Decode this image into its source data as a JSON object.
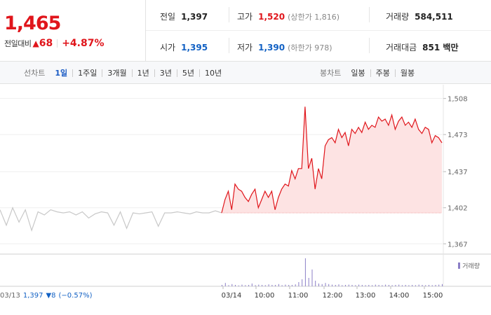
{
  "summary": {
    "price": "1,465",
    "change_label": "전일대비",
    "change_value": "68",
    "change_pct": "+4.87%",
    "stats": {
      "prev_label": "전일",
      "prev_value": "1,397",
      "high_label": "고가",
      "high_value": "1,520",
      "high_sub": "(상한가 1,816)",
      "volume_label": "거래량",
      "volume_value": "584,511",
      "open_label": "시가",
      "open_value": "1,395",
      "low_label": "저가",
      "low_value": "1,390",
      "low_sub": "(하한가 978)",
      "amount_label": "거래대금",
      "amount_value": "851 백만"
    }
  },
  "toolbar": {
    "line_title": "선차트",
    "line_items": [
      "1일",
      "1주일",
      "3개월",
      "1년",
      "3년",
      "5년",
      "10년"
    ],
    "line_active": "1일",
    "candle_title": "봉차트",
    "candle_items": [
      "일봉",
      "주봉",
      "월봉"
    ]
  },
  "footer": {
    "prev_date": "03/13",
    "prev_price": "1,397",
    "prev_change": "▼8",
    "prev_pct": "(−0.57%)"
  },
  "legend": {
    "volume": "거래량"
  },
  "colors": {
    "up": "#e0151b",
    "down": "#1261c4",
    "area": "#fde3e3",
    "prev_line": "#c8c8c8",
    "volume": "#8b7fc7"
  },
  "chart_data": {
    "type": "line",
    "y_ticks": [
      "1,508",
      "1,473",
      "1,437",
      "1,402",
      "1,367"
    ],
    "y_tick_values": [
      1508,
      1473,
      1437,
      1402,
      1367
    ],
    "ylim": [
      1357,
      1520
    ],
    "x_ticks": [
      "03/14",
      "10:00",
      "11:00",
      "12:00",
      "13:00",
      "14:00",
      "15:00"
    ],
    "base_price": 1397,
    "prev_day_series": [
      [
        0,
        1400
      ],
      [
        1,
        1385
      ],
      [
        2,
        1402
      ],
      [
        3,
        1388
      ],
      [
        4,
        1400
      ],
      [
        5,
        1380
      ],
      [
        6,
        1398
      ],
      [
        7,
        1395
      ],
      [
        8,
        1400
      ],
      [
        9,
        1398
      ],
      [
        10,
        1397
      ],
      [
        11,
        1398
      ],
      [
        12,
        1395
      ],
      [
        13,
        1398
      ],
      [
        14,
        1392
      ],
      [
        15,
        1396
      ],
      [
        16,
        1398
      ],
      [
        17,
        1397
      ],
      [
        18,
        1385
      ],
      [
        19,
        1398
      ],
      [
        20,
        1382
      ],
      [
        21,
        1397
      ],
      [
        22,
        1396
      ],
      [
        23,
        1397
      ],
      [
        24,
        1398
      ],
      [
        25,
        1384
      ],
      [
        26,
        1397
      ],
      [
        27,
        1397
      ],
      [
        28,
        1398
      ],
      [
        29,
        1397
      ],
      [
        30,
        1396
      ],
      [
        31,
        1398
      ],
      [
        32,
        1397
      ],
      [
        33,
        1397
      ],
      [
        34,
        1399
      ],
      [
        35,
        1397
      ]
    ],
    "today_series": [
      [
        0,
        1397
      ],
      [
        1,
        1410
      ],
      [
        2,
        1418
      ],
      [
        3,
        1400
      ],
      [
        4,
        1425
      ],
      [
        5,
        1420
      ],
      [
        6,
        1418
      ],
      [
        7,
        1412
      ],
      [
        8,
        1408
      ],
      [
        9,
        1415
      ],
      [
        10,
        1420
      ],
      [
        11,
        1402
      ],
      [
        12,
        1410
      ],
      [
        13,
        1418
      ],
      [
        14,
        1412
      ],
      [
        15,
        1418
      ],
      [
        16,
        1400
      ],
      [
        17,
        1412
      ],
      [
        18,
        1420
      ],
      [
        19,
        1425
      ],
      [
        20,
        1423
      ],
      [
        21,
        1438
      ],
      [
        22,
        1430
      ],
      [
        23,
        1440
      ],
      [
        24,
        1440
      ],
      [
        25,
        1500
      ],
      [
        26,
        1440
      ],
      [
        27,
        1450
      ],
      [
        28,
        1420
      ],
      [
        29,
        1440
      ],
      [
        30,
        1430
      ],
      [
        31,
        1462
      ],
      [
        32,
        1468
      ],
      [
        33,
        1470
      ],
      [
        34,
        1465
      ],
      [
        35,
        1478
      ],
      [
        36,
        1470
      ],
      [
        37,
        1475
      ],
      [
        38,
        1462
      ],
      [
        39,
        1478
      ],
      [
        40,
        1474
      ],
      [
        41,
        1480
      ],
      [
        42,
        1475
      ],
      [
        43,
        1485
      ],
      [
        44,
        1478
      ],
      [
        45,
        1482
      ],
      [
        46,
        1480
      ],
      [
        47,
        1490
      ],
      [
        48,
        1486
      ],
      [
        49,
        1488
      ],
      [
        50,
        1482
      ],
      [
        51,
        1492
      ],
      [
        52,
        1478
      ],
      [
        53,
        1486
      ],
      [
        54,
        1490
      ],
      [
        55,
        1482
      ],
      [
        56,
        1485
      ],
      [
        57,
        1480
      ],
      [
        58,
        1488
      ],
      [
        59,
        1478
      ],
      [
        60,
        1474
      ],
      [
        61,
        1480
      ],
      [
        62,
        1478
      ],
      [
        63,
        1465
      ],
      [
        64,
        1472
      ],
      [
        65,
        1470
      ],
      [
        66,
        1465
      ]
    ],
    "volume_series": [
      0.05,
      0.12,
      0.04,
      0.08,
      0.05,
      0.03,
      0.06,
      0.04,
      0.05,
      0.1,
      0.04,
      0.06,
      0.05,
      0.04,
      0.07,
      0.05,
      0.05,
      0.08,
      0.04,
      0.06,
      0.05,
      0.05,
      0.07,
      0.15,
      0.25,
      1.0,
      0.3,
      0.6,
      0.2,
      0.1,
      0.08,
      0.12,
      0.08,
      0.06,
      0.05,
      0.07,
      0.04,
      0.05,
      0.06,
      0.05,
      0.04,
      0.06,
      0.05,
      0.04,
      0.05,
      0.04,
      0.06,
      0.05,
      0.04,
      0.06,
      0.05,
      0.04,
      0.05,
      0.06,
      0.04,
      0.05,
      0.04,
      0.05,
      0.04,
      0.06,
      0.05,
      0.04,
      0.05,
      0.04,
      0.05,
      0.06,
      0.08
    ]
  }
}
